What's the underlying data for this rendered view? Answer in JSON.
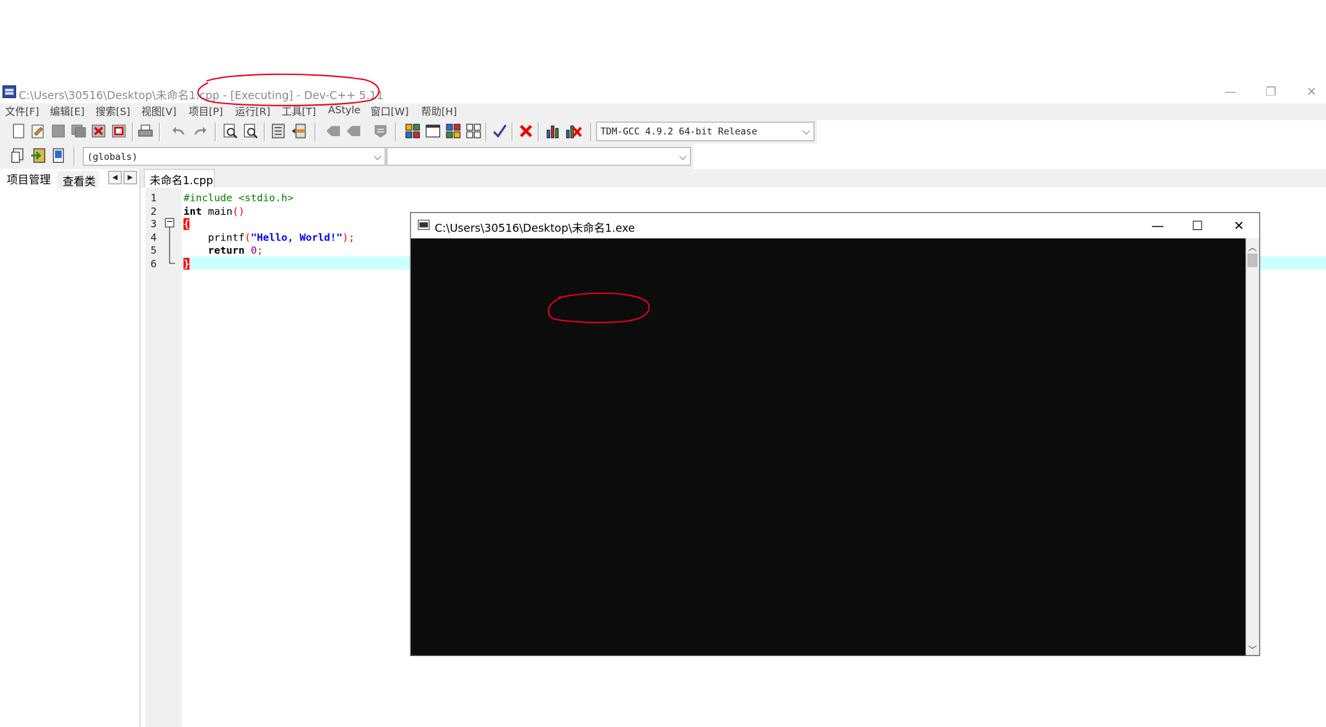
{
  "window": {
    "title": "C:\\Users\\30516\\Desktop\\未命名1.cpp - [Executing] - Dev-C++ 5.11",
    "minimize": "—",
    "maximize": "❐",
    "close": "✕"
  },
  "menu": [
    "文件[F]",
    "编辑[E]",
    "搜索[S]",
    "视图[V]",
    "项目[P]",
    "运行[R]",
    "工具[T]",
    "AStyle",
    "窗口[W]",
    "帮助[H]"
  ],
  "toolbar": {
    "compiler": "TDM-GCC 4.9.2 64-bit Release",
    "scope": "(globals)",
    "symbol": ""
  },
  "left_panel": {
    "tabs": [
      "项目管理",
      "查看类"
    ],
    "scroll_left": "◀",
    "scroll_right": "▶"
  },
  "editor": {
    "tab": "未命名1.cpp",
    "line_numbers": [
      "1",
      "2",
      "3",
      "4",
      "5",
      "6"
    ],
    "code": {
      "l1": "#include <stdio.h>",
      "l2_kw": "int",
      "l2_rest": " main",
      "l2_paren": "()",
      "l3_brace": "{",
      "l4_fn": "printf",
      "l4_paren_open": "(",
      "l4_str": "\"Hello, World!\"",
      "l4_paren_close": ")",
      "l4_semi": ";",
      "l5_kw": "return",
      "l5_num": "0",
      "l5_semi": ";",
      "l6_brace": "}"
    },
    "fold_symbol": "−"
  },
  "console": {
    "title": "C:\\Users\\30516\\Desktop\\未命名1.exe",
    "minimize": "—",
    "maximize": "☐",
    "close": "✕",
    "up_arrow": "︿",
    "down_arrow": "﹀"
  },
  "colors": {
    "annotation": "#e8001c",
    "console_bg": "#0c0c0c",
    "current_line": "#ccffff",
    "preprocessor": "#008000",
    "keyword": "#000000",
    "string": "#0000ff",
    "number": "#800080",
    "symbol": "#ff0000"
  }
}
